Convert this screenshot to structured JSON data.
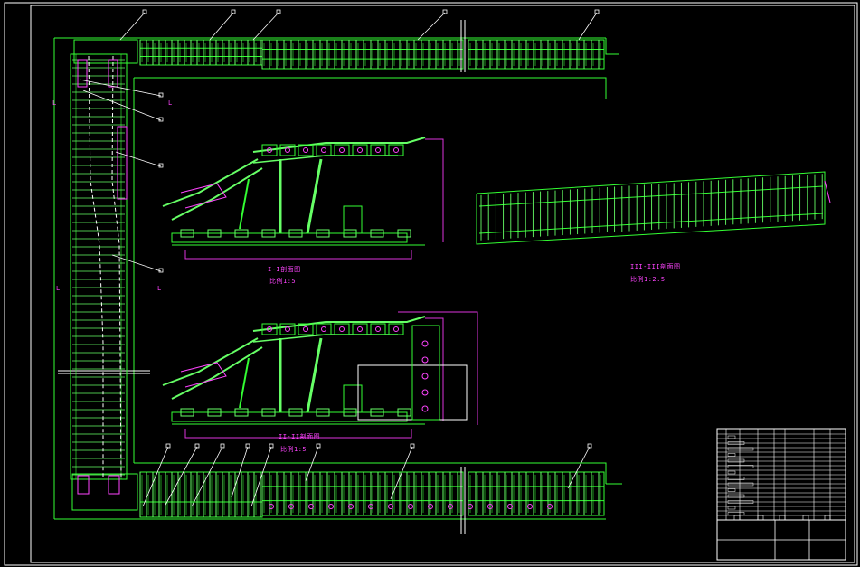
{
  "colors": {
    "background": "#000000",
    "frame": "#ffffff",
    "support": "#33ff33",
    "support_bright": "#66ff66",
    "hydraulic": "#ff44ff",
    "dimension": "#dd33dd",
    "callout": "#ffffff"
  },
  "views": {
    "section_1": {
      "title": "I-I剖面图",
      "scale": "比例1:5"
    },
    "section_2": {
      "title": "II-II剖面图",
      "scale": "比例1:5"
    },
    "section_3": {
      "title": "III-III剖面图",
      "scale": "比例1:2.5"
    }
  },
  "side_marks": {
    "left_top": "L",
    "right_top": "L",
    "left_mid": "L",
    "right_mid": "L"
  },
  "callouts": {
    "top_count": 5,
    "left_count": 4,
    "bottom_count": 7
  },
  "title_block": {
    "visible_text": ""
  }
}
